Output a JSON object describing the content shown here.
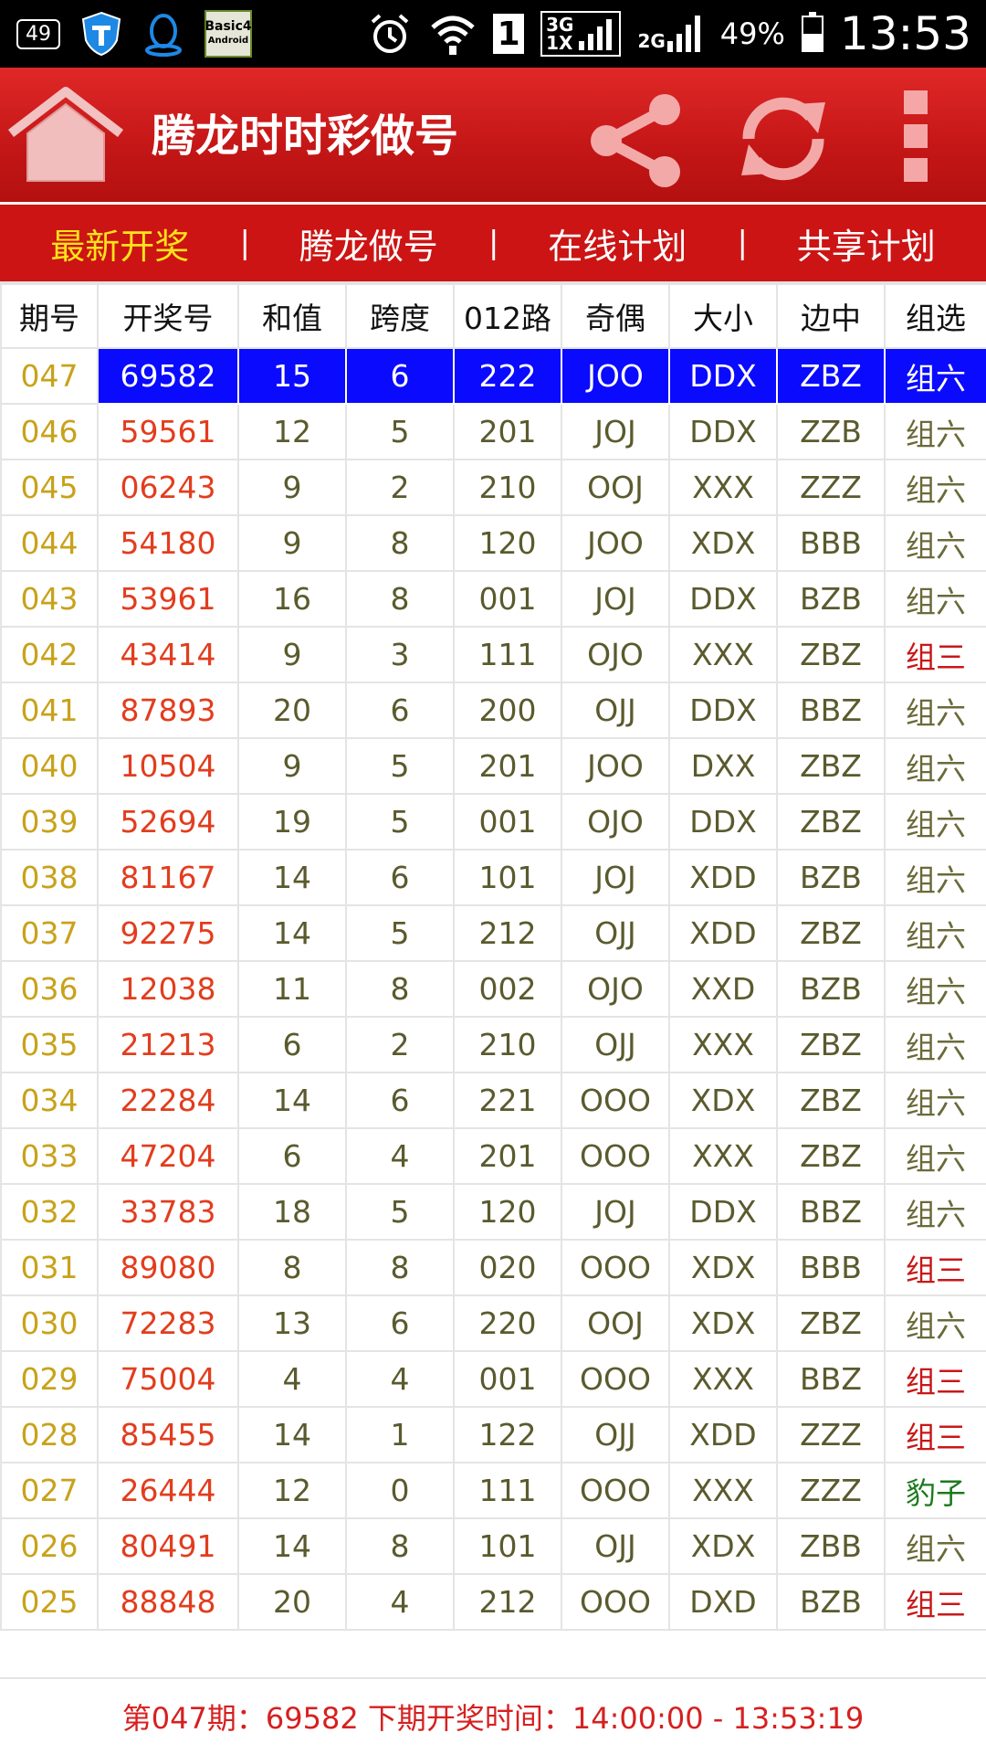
{
  "status_bar": {
    "notification_count": "49",
    "b4a_line1": "Basic4",
    "b4a_line2": "Android",
    "sim_slot": "1",
    "net_3g": "3G",
    "net_1x": "1X",
    "net_2g": "2G",
    "battery_pct": "49%",
    "battery_level": 0.49,
    "time": "13:53"
  },
  "app_bar": {
    "title": "腾龙时时彩做号",
    "icons": [
      "home-icon",
      "share-icon",
      "refresh-icon",
      "more-vert-icon"
    ]
  },
  "tabs": [
    {
      "label": "最新开奖",
      "active": true
    },
    {
      "label": "腾龙做号",
      "active": false
    },
    {
      "label": "在线计划",
      "active": false
    },
    {
      "label": "共享计划",
      "active": false
    }
  ],
  "tab_separator": "|",
  "table": {
    "headers": [
      "期号",
      "开奖号",
      "和值",
      "跨度",
      "012路",
      "奇偶",
      "大小",
      "边中",
      "组选"
    ],
    "rows": [
      [
        "047",
        "69582",
        "15",
        "6",
        "222",
        "JOO",
        "DDX",
        "ZBZ",
        "组六"
      ],
      [
        "046",
        "59561",
        "12",
        "5",
        "201",
        "JOJ",
        "DDX",
        "ZZB",
        "组六"
      ],
      [
        "045",
        "06243",
        "9",
        "2",
        "210",
        "OOJ",
        "XXX",
        "ZZZ",
        "组六"
      ],
      [
        "044",
        "54180",
        "9",
        "8",
        "120",
        "JOO",
        "XDX",
        "BBB",
        "组六"
      ],
      [
        "043",
        "53961",
        "16",
        "8",
        "001",
        "JOJ",
        "DDX",
        "BZB",
        "组六"
      ],
      [
        "042",
        "43414",
        "9",
        "3",
        "111",
        "OJO",
        "XXX",
        "ZBZ",
        "组三"
      ],
      [
        "041",
        "87893",
        "20",
        "6",
        "200",
        "OJJ",
        "DDX",
        "BBZ",
        "组六"
      ],
      [
        "040",
        "10504",
        "9",
        "5",
        "201",
        "JOO",
        "DXX",
        "ZBZ",
        "组六"
      ],
      [
        "039",
        "52694",
        "19",
        "5",
        "001",
        "OJO",
        "DDX",
        "ZBZ",
        "组六"
      ],
      [
        "038",
        "81167",
        "14",
        "6",
        "101",
        "JOJ",
        "XDD",
        "BZB",
        "组六"
      ],
      [
        "037",
        "92275",
        "14",
        "5",
        "212",
        "OJJ",
        "XDD",
        "ZBZ",
        "组六"
      ],
      [
        "036",
        "12038",
        "11",
        "8",
        "002",
        "OJO",
        "XXD",
        "BZB",
        "组六"
      ],
      [
        "035",
        "21213",
        "6",
        "2",
        "210",
        "OJJ",
        "XXX",
        "ZBZ",
        "组六"
      ],
      [
        "034",
        "22284",
        "14",
        "6",
        "221",
        "OOO",
        "XDX",
        "ZBZ",
        "组六"
      ],
      [
        "033",
        "47204",
        "6",
        "4",
        "201",
        "OOO",
        "XXX",
        "ZBZ",
        "组六"
      ],
      [
        "032",
        "33783",
        "18",
        "5",
        "120",
        "JOJ",
        "DDX",
        "BBZ",
        "组六"
      ],
      [
        "031",
        "89080",
        "8",
        "8",
        "020",
        "OOO",
        "XDX",
        "BBB",
        "组三"
      ],
      [
        "030",
        "72283",
        "13",
        "6",
        "220",
        "OOJ",
        "XDX",
        "ZBZ",
        "组六"
      ],
      [
        "029",
        "75004",
        "4",
        "4",
        "001",
        "OOO",
        "XXX",
        "BBZ",
        "组三"
      ],
      [
        "028",
        "85455",
        "14",
        "1",
        "122",
        "OJJ",
        "XDD",
        "ZZZ",
        "组三"
      ],
      [
        "027",
        "26444",
        "12",
        "0",
        "111",
        "OOO",
        "XXX",
        "ZZZ",
        "豹子"
      ],
      [
        "026",
        "80491",
        "14",
        "8",
        "101",
        "OJJ",
        "XDX",
        "ZBB",
        "组六"
      ],
      [
        "025",
        "88848",
        "20",
        "4",
        "212",
        "OOO",
        "DXD",
        "BZB",
        "组三"
      ]
    ],
    "selected_row": 0
  },
  "footer": {
    "text": "第047期：69582  下期开奖时间：14:00:00 - 13:53:19"
  }
}
